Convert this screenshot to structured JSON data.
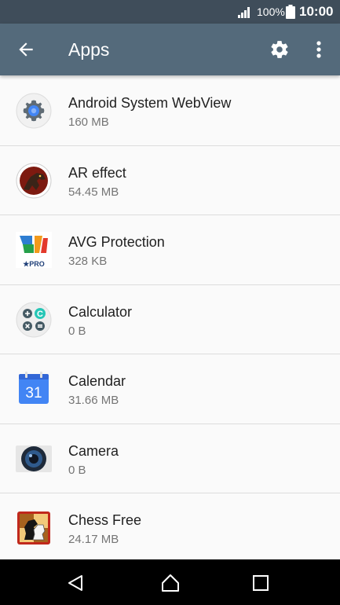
{
  "status_bar": {
    "battery_percent": "100%",
    "time": "10:00",
    "icons": [
      "signal-icon",
      "battery-icon"
    ]
  },
  "app_bar": {
    "title": "Apps",
    "icons": [
      "back-arrow-icon",
      "settings-gear-icon",
      "more-vert-icon"
    ]
  },
  "apps": [
    {
      "name": "Android System WebView",
      "size": "160 MB",
      "icon": "webview-gear-icon"
    },
    {
      "name": "AR effect",
      "size": "54.45 MB",
      "icon": "ar-effect-dinosaur-icon"
    },
    {
      "name": "AVG Protection",
      "size": "328 KB",
      "icon": "avg-protection-icon",
      "icon_text": "★PRO"
    },
    {
      "name": "Calculator",
      "size": "0 B",
      "icon": "calculator-icon",
      "icon_text": "C"
    },
    {
      "name": "Calendar",
      "size": "31.66 MB",
      "icon": "calendar-icon",
      "icon_text": "31"
    },
    {
      "name": "Camera",
      "size": "0 B",
      "icon": "camera-icon"
    },
    {
      "name": "Chess Free",
      "size": "24.17 MB",
      "icon": "chess-free-icon"
    }
  ],
  "nav_bar": {
    "icons": [
      "nav-back-icon",
      "nav-home-icon",
      "nav-recents-icon"
    ]
  },
  "colors": {
    "status_bar": "#3f4d5a",
    "app_bar": "#546a7b",
    "background": "#fafafa",
    "calendar_blue": "#4285f4"
  }
}
